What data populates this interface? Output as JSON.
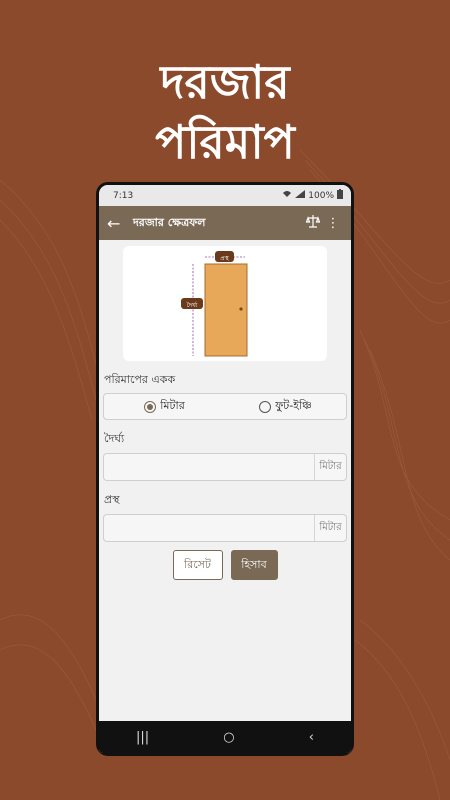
{
  "promo": {
    "line1": "দরজার",
    "line2": "পরিমাপ"
  },
  "status_bar": {
    "time": "7:13",
    "battery": "100%"
  },
  "appbar": {
    "title": "দরজার ক্ষেত্রফল",
    "back_icon": "arrow-left-icon",
    "action_icon": "balance-scale-icon",
    "menu_icon": "more-vertical-icon"
  },
  "diagram": {
    "width_label": "প্রস্থ",
    "height_label": "দৈর্ঘ্য",
    "door_color": "#e8a85a"
  },
  "unit_section": {
    "label": "পরিমাপের একক",
    "options": [
      {
        "label": "মিটার",
        "selected": true
      },
      {
        "label": "ফুট-ইঞ্চি",
        "selected": false
      }
    ]
  },
  "length_field": {
    "label": "দৈর্ঘ্য",
    "value": "",
    "suffix": "মিটার"
  },
  "width_field": {
    "label": "প্রস্থ",
    "value": "",
    "suffix": "মিটার"
  },
  "buttons": {
    "reset": "রিসেট",
    "calculate": "হিসাব"
  },
  "colors": {
    "background": "#8b4a2b",
    "appbar": "#7a6a55",
    "accent": "#7a6a55"
  }
}
